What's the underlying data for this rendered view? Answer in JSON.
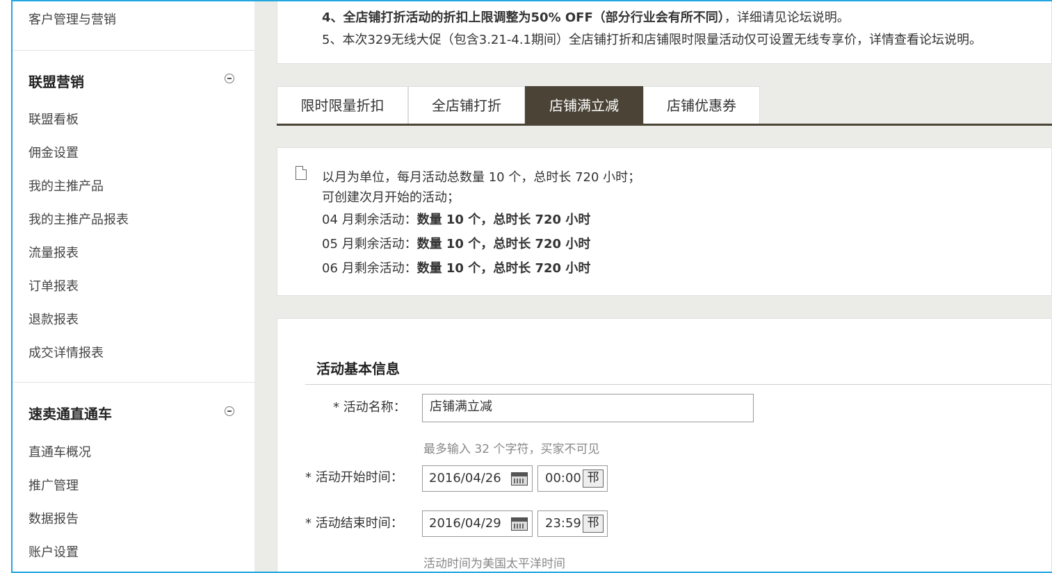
{
  "sidebar": {
    "top_item": "客户管理与营销",
    "section1": {
      "title": "联盟营销",
      "items": [
        "联盟看板",
        "佣金设置",
        "我的主推产品",
        "我的主推产品报表",
        "流量报表",
        "订单报表",
        "退款报表",
        "成交详情报表"
      ]
    },
    "section2": {
      "title": "速卖通直通车",
      "items": [
        "直通车概况",
        "推广管理",
        "数据报告",
        "账户设置"
      ]
    }
  },
  "notice": {
    "line4_bold": "4、全店铺打折活动的折扣上限调整为50% OFF（部分行业会有所不同）",
    "line4_rest": "，详细请见论坛说明。",
    "line5": "5、本次329无线大促（包含3.21-4.1期间）全店铺打折和店铺限时限量活动仅可设置无线专享价，详情查看论坛说明。"
  },
  "tabs": [
    {
      "label": "限时限量折扣",
      "active": false
    },
    {
      "label": "全店铺打折",
      "active": false
    },
    {
      "label": "店铺满立减",
      "active": true
    },
    {
      "label": "店铺优惠券",
      "active": false
    }
  ],
  "quota": {
    "line1": "以月为单位，每月活动总数量 10 个，总时长 720 小时；",
    "line2": "可创建次月开始的活动；",
    "months": [
      {
        "prefix": "04 月剩余活动：",
        "count": "数量 10 个，",
        "hours": "总时长 720 小时"
      },
      {
        "prefix": "05 月剩余活动：",
        "count": "数量 10 个，",
        "hours": "总时长 720 小时"
      },
      {
        "prefix": "06 月剩余活动：",
        "count": "数量 10 个，",
        "hours": "总时长 720 小时"
      }
    ]
  },
  "form": {
    "title": "活动基本信息",
    "name_label": "* 活动名称：",
    "name_value": "店铺满立减",
    "name_hint": "最多输入 32 个字符，买家不可见",
    "start_label": "* 活动开始时间：",
    "start_date": "2016/04/26",
    "start_time": "00:00",
    "end_label": "* 活动结束时间：",
    "end_date": "2016/04/29",
    "end_time": "23:59",
    "time_btn": "邗",
    "time_hint": "活动时间为美国太平洋时间"
  },
  "colors": {
    "accent_border": "#22a7e0",
    "tab_active": "#4a4336"
  }
}
